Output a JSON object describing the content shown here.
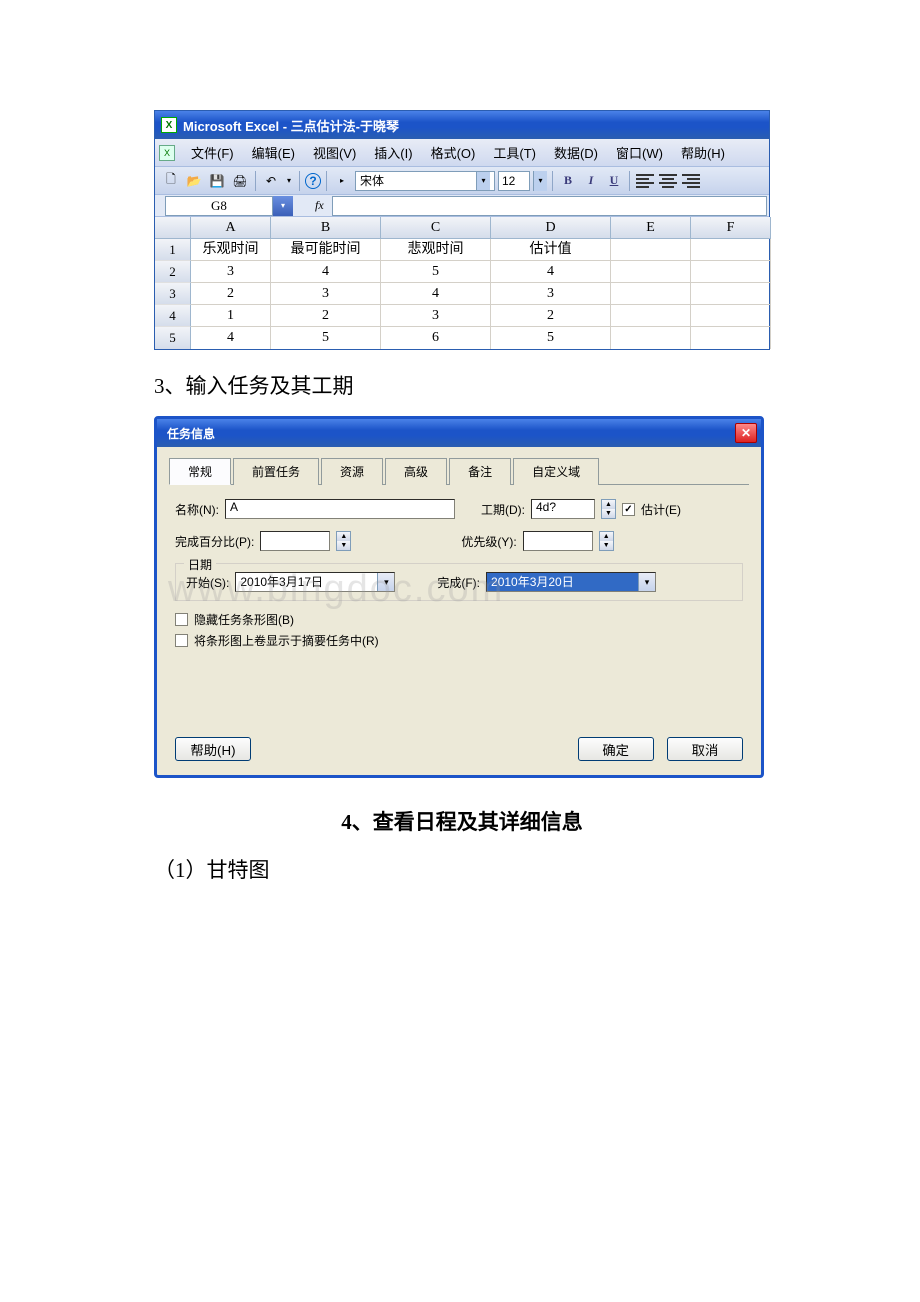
{
  "excel": {
    "title": "Microsoft Excel - 三点估计法-于晓琴",
    "menus": [
      "文件(F)",
      "编辑(E)",
      "视图(V)",
      "插入(I)",
      "格式(O)",
      "工具(T)",
      "数据(D)",
      "窗口(W)",
      "帮助(H)"
    ],
    "font_name": "宋体",
    "font_size": "12",
    "namebox": "G8",
    "cols": [
      "A",
      "B",
      "C",
      "D",
      "E",
      "F"
    ],
    "headers": [
      "乐观时间",
      "最可能时间",
      "悲观时间",
      "估计值",
      "",
      ""
    ],
    "rows": [
      [
        "3",
        "4",
        "5",
        "4",
        "",
        ""
      ],
      [
        "2",
        "3",
        "4",
        "3",
        "",
        ""
      ],
      [
        "1",
        "2",
        "3",
        "2",
        "",
        ""
      ],
      [
        "4",
        "5",
        "6",
        "5",
        "",
        ""
      ]
    ]
  },
  "text": {
    "step3": "3、输入任务及其工期",
    "step4": "4、查看日程及其详细信息",
    "gantt": "（1）甘特图"
  },
  "dialog": {
    "title": "任务信息",
    "tabs": [
      "常规",
      "前置任务",
      "资源",
      "高级",
      "备注",
      "自定义域"
    ],
    "name_label": "名称(N):",
    "name_value": "A",
    "dur_label": "工期(D):",
    "dur_value": "4d?",
    "est_label": "估计(E)",
    "pct_label": "完成百分比(P):",
    "pri_label": "优先级(Y):",
    "date_legend": "日期",
    "start_label": "开始(S):",
    "start_value": "2010年3月17日",
    "finish_label": "完成(F):",
    "finish_value": "2010年3月20日",
    "chk1": "隐藏任务条形图(B)",
    "chk2": "将条形图上卷显示于摘要任务中(R)",
    "help": "帮助(H)",
    "ok": "确定",
    "cancel": "取消"
  },
  "watermark": "www.bingdoc.com"
}
